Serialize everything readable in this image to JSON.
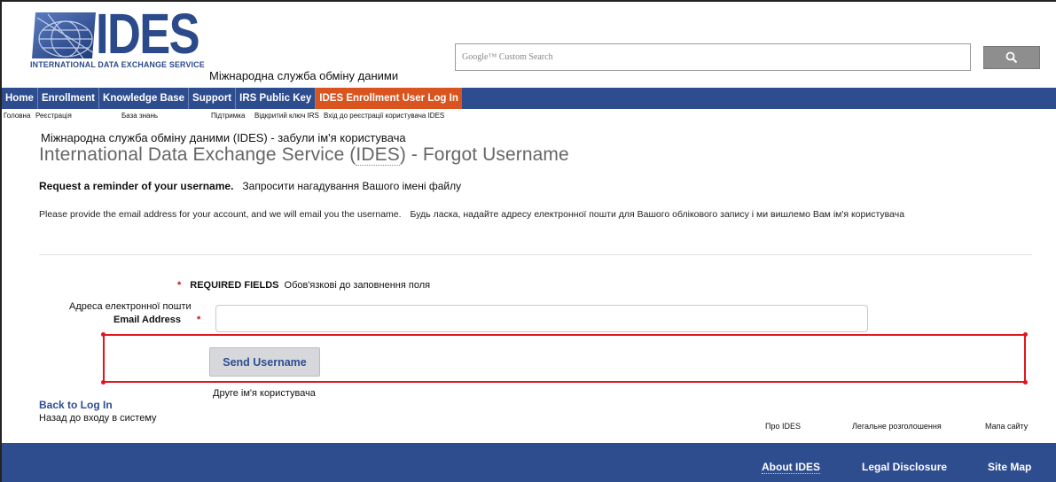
{
  "header": {
    "logo_text": "IDES",
    "logo_subtitle": "INTERNATIONAL DATA EXCHANGE SERVICE",
    "logo_ukr": "Міжнародна служба обміну даними",
    "search_placeholder": "Google™ Custom Search",
    "search_button_icon": "search-icon"
  },
  "nav": {
    "items": [
      {
        "label": "Home",
        "ukr": "Головна"
      },
      {
        "label": "Enrollment",
        "ukr": "Реєстрація"
      },
      {
        "label": "Knowledge Base",
        "ukr": "База знань"
      },
      {
        "label": "Support",
        "ukr": "Підтримка"
      },
      {
        "label": "IRS Public Key",
        "ukr": "Відкритий ключ IRS"
      },
      {
        "label": "IDES Enrollment User Log In",
        "ukr": "Вхід до реєстрації користувача IDES"
      }
    ],
    "active_color": "#d9541e",
    "bar_color": "#2e4d8f"
  },
  "main": {
    "title_ukr": "Міжнародна служба обміну даними (IDES) - забули ім'я користувача",
    "title_prefix": "International Data Exchange Service (",
    "title_abbr": "IDES",
    "title_suffix": ") - Forgot Username",
    "request_en": "Request a reminder of your username.",
    "request_ukr": "Запросити нагадування Вашого імені файлу",
    "instruction_en": "Please provide the email address for your account, and we will email you the username.",
    "instruction_ukr": "Будь ласка, надайте адресу електронної пошти для Вашого облікового запису і ми вишлемо Вам ім'я користувача",
    "required_star": "*",
    "required_en": "REQUIRED FIELDS",
    "required_ukr": "Обов'язкові до заповнення поля",
    "email_ukr": "Адреса електронної пошти",
    "email_label": "Email Address",
    "email_star": "*",
    "email_value": "",
    "send_button": "Send Username",
    "send_ukr": "Друге ім'я користувача",
    "back_link": "Back to Log In",
    "back_ukr": "Назад до входу в систему"
  },
  "footer": {
    "about": "About IDES",
    "about_ukr": "Про IDES",
    "legal": "Legal Disclosure",
    "legal_ukr": "Легальне розголошення",
    "sitemap": "Site Map",
    "sitemap_ukr": "Мапа сайту"
  },
  "colors": {
    "highlight": "#e0161e",
    "link": "#2e4d8f"
  }
}
